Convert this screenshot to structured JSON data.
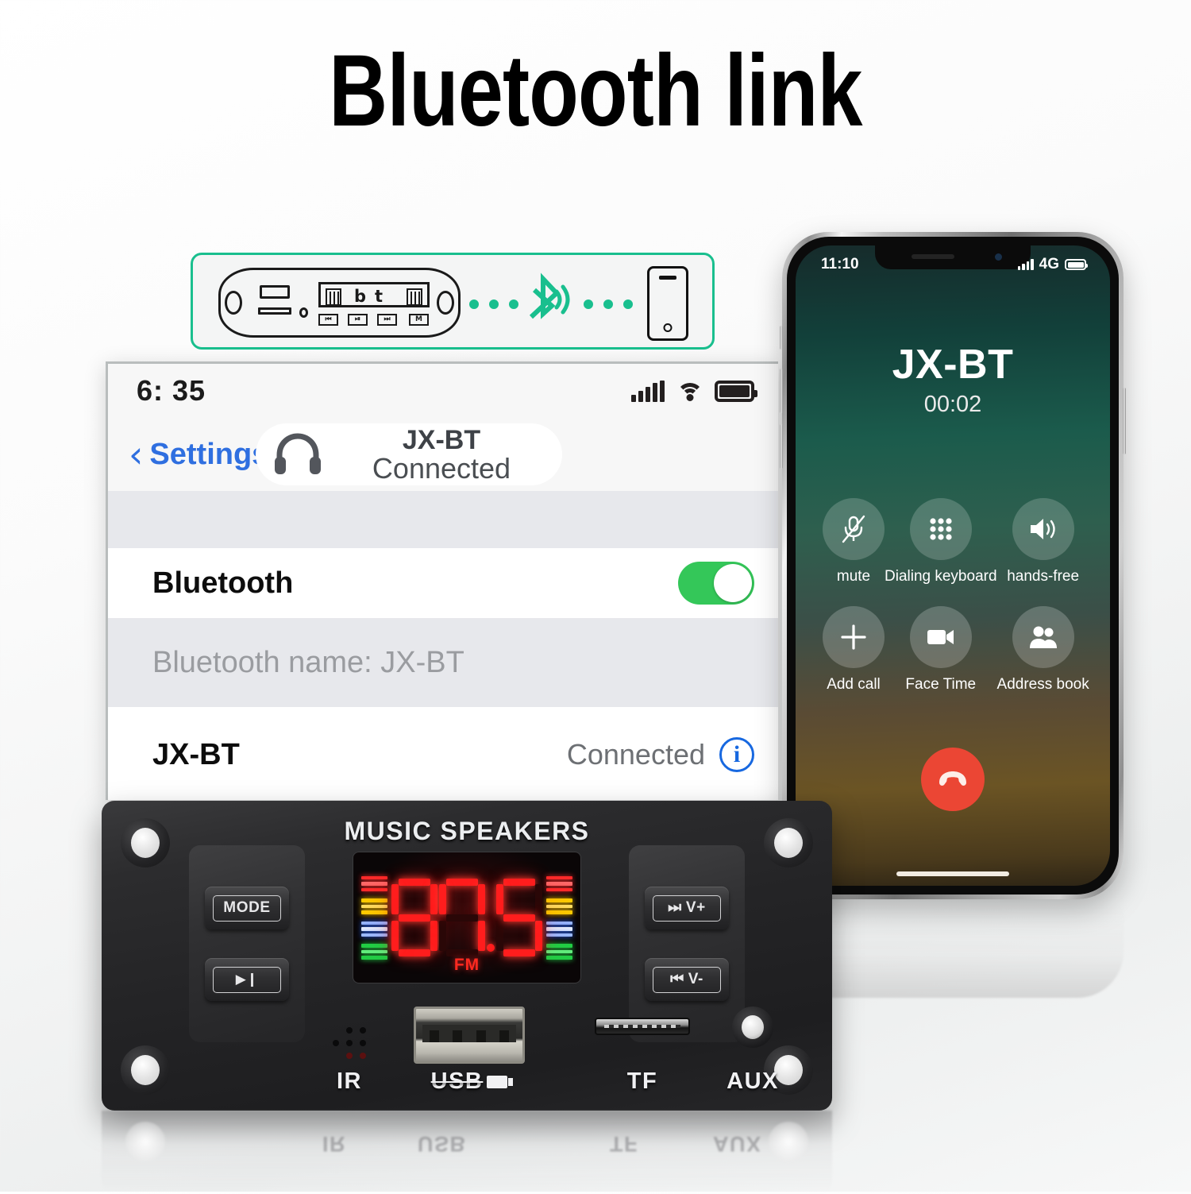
{
  "title": "Bluetooth link",
  "diagram": {
    "board_keys": [
      "⏮",
      "⏯",
      "⏭",
      "M"
    ],
    "bt_icon": "bluetooth-icon",
    "phone_icon": "smartphone-outline-icon",
    "accent_color": "#19bf8e"
  },
  "settings": {
    "status_bar": {
      "time": "6: 35",
      "signal_icon": "cellular-signal-icon",
      "wifi_icon": "wifi-icon",
      "battery_icon": "battery-icon"
    },
    "nav": {
      "back_label": "Settings",
      "back_chevron": "‹",
      "device_icon": "headphones-icon",
      "device_name": "JX-BT",
      "device_status": "Connected"
    },
    "rows": [
      {
        "label": "Bluetooth",
        "toggle": "on",
        "toggle_color": "#34c759"
      },
      {
        "note": "Bluetooth name: JX-BT"
      },
      {
        "label": "JX-BT",
        "status": "Connected",
        "info_icon": "info-circle-icon"
      }
    ]
  },
  "phone": {
    "status_bar": {
      "time": "11:10",
      "signal_icon": "cellular-signal-icon",
      "network": "4G",
      "battery_icon": "battery-icon"
    },
    "call": {
      "contact": "JX-BT",
      "duration": "00:02",
      "buttons": [
        {
          "label": "mute",
          "icon": "microphone-muted-icon"
        },
        {
          "label": "Dialing keyboard",
          "icon": "keypad-icon"
        },
        {
          "label": "hands-free",
          "icon": "speaker-icon"
        },
        {
          "label": "Add call",
          "icon": "plus-icon"
        },
        {
          "label": "Face Time",
          "icon": "video-camera-icon"
        },
        {
          "label": "Address book",
          "icon": "contacts-icon"
        }
      ],
      "hangup": {
        "label": "End call",
        "icon": "phone-down-icon",
        "color": "#eb4634"
      }
    }
  },
  "board": {
    "title": "MUSIC SPEAKERS",
    "buttons": {
      "mode": "MODE",
      "play_pause": "▶❙",
      "next_volume_up": "V+",
      "next_volume_up_icon": "⏭",
      "prev_volume_down": "V-",
      "prev_volume_down_icon": "⏮"
    },
    "display": {
      "value": "87.5",
      "digits": [
        "8",
        "7",
        "5"
      ],
      "decimal_point": true,
      "mode_label": "FM",
      "led_color": "#ff1d1d",
      "vu_colors": [
        "#ff2a2a",
        "#ffcc00",
        "#2b6bff",
        "#22cc44"
      ]
    },
    "ports": [
      {
        "label": "IR",
        "icon": "ir-receiver-icon"
      },
      {
        "label": "USB",
        "icon": "usb-port-icon"
      },
      {
        "label": "TF",
        "icon": "microsd-slot-icon"
      },
      {
        "label": "AUX",
        "icon": "aux-jack-icon"
      }
    ]
  }
}
